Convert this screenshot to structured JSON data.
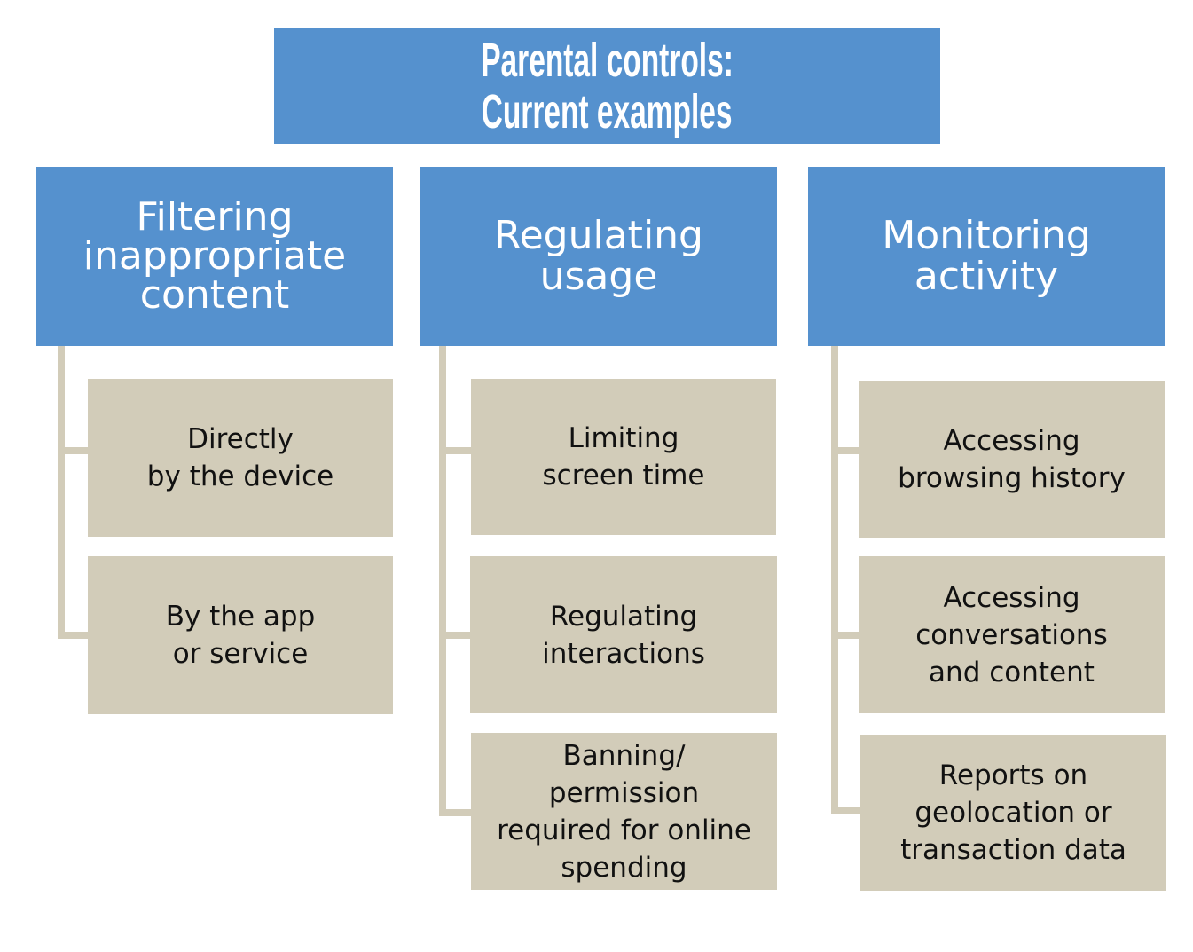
{
  "title": {
    "line1": "Parental controls:",
    "line2": "Current examples"
  },
  "colors": {
    "header_blue": "#5591ce",
    "child_tan": "#d2ccb9",
    "header_text": "#ffffff",
    "child_text": "#111111"
  },
  "columns": [
    {
      "heading": [
        "Filtering",
        "inappropriate",
        "content"
      ],
      "items": [
        [
          "Directly",
          "by the device"
        ],
        [
          "By the app",
          "or service"
        ]
      ]
    },
    {
      "heading": [
        "Regulating",
        "usage"
      ],
      "items": [
        [
          "Limiting",
          "screen time"
        ],
        [
          "Regulating",
          "interactions"
        ],
        [
          "Banning/",
          "permission",
          "required for online",
          "spending"
        ]
      ]
    },
    {
      "heading": [
        "Monitoring",
        "activity"
      ],
      "items": [
        [
          "Accessing",
          "browsing history"
        ],
        [
          "Accessing",
          "conversations",
          "and content"
        ],
        [
          "Reports on",
          "geolocation or",
          "transaction data"
        ]
      ]
    }
  ]
}
